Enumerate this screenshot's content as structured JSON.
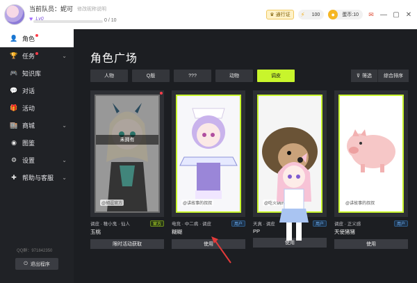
{
  "titlebar": {
    "user_name": "当前队员：妮可",
    "user_edit": "修改昵称说明",
    "level": "Lv0",
    "xp_text": "0 / 10",
    "xp_fraction": 0,
    "pass_label": "通行证",
    "energy": "100",
    "coins": "蛋币:10"
  },
  "sidebar": {
    "items": [
      {
        "label": "角色",
        "icon": "user-icon"
      },
      {
        "label": "任务",
        "icon": "trophy-icon"
      },
      {
        "label": "知识库",
        "icon": "gamepad-icon"
      },
      {
        "label": "对话",
        "icon": "chat-icon"
      },
      {
        "label": "活动",
        "icon": "gift-icon"
      },
      {
        "label": "商城",
        "icon": "shop-icon"
      },
      {
        "label": "图鉴",
        "icon": "gallery-icon"
      },
      {
        "label": "设置",
        "icon": "gear-icon"
      },
      {
        "label": "帮助与客服",
        "icon": "help-icon"
      }
    ],
    "qq": "QQ群：971842350",
    "logout": "退出程序"
  },
  "main": {
    "title": "角色广场",
    "filters": [
      "人物",
      "Q版",
      "???",
      "动物",
      "调皮"
    ],
    "active_filter": 4,
    "filter_btn": "筛选",
    "sort_btn": "综合排序",
    "cards": [
      {
        "tags": "调皮 · 稚小鬼 · 仙人",
        "name": "玉桃",
        "badge": "官方",
        "author": "@胡逗官方",
        "button": "限时活动获取",
        "owned_label": "未拥有"
      },
      {
        "tags": "电竞 · 中二病 · 调皮",
        "name": "糊糊",
        "badge": "用户",
        "author": "@讲故事的叔叔",
        "button": "使用"
      },
      {
        "tags": "天真 · 调皮",
        "name": "PP",
        "badge": "用户",
        "author": "@吃火锅的小毛",
        "button": "使用"
      },
      {
        "tags": "调皮 · 正义感",
        "name": "天使猪猪",
        "badge": "用户",
        "author": "@讲故事的叔叔",
        "button": "使用"
      }
    ]
  },
  "colors": {
    "accent": "#c8f52c",
    "dark_bg": "#1c1e22",
    "sidebar_bg": "#202226"
  }
}
